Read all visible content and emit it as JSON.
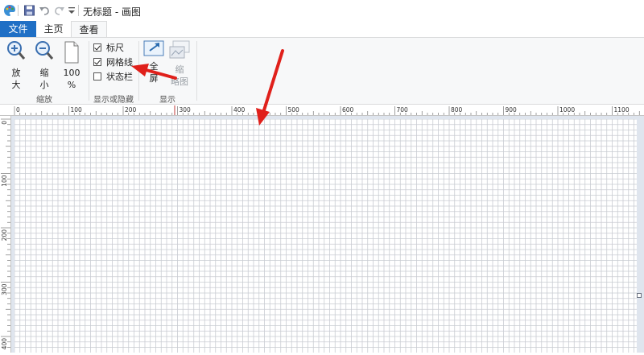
{
  "window": {
    "title": "无标题 - 画图"
  },
  "quick_access": {
    "icons": [
      "paint-app-icon",
      "save-icon",
      "undo-icon",
      "redo-icon",
      "customize-dropdown-icon"
    ]
  },
  "tabs": [
    {
      "label": "文件",
      "active": false
    },
    {
      "label": "主页",
      "active": false
    },
    {
      "label": "查看",
      "active": true
    }
  ],
  "ribbon": {
    "zoom_group": {
      "label": "缩放",
      "zoom_in": {
        "line1": "放",
        "line2": "大"
      },
      "zoom_out": {
        "line1": "缩",
        "line2": "小"
      },
      "actual_size": {
        "line1": "100",
        "line2": "%"
      }
    },
    "show_hide_group": {
      "label": "显示或隐藏",
      "checkboxes": [
        {
          "label": "标尺",
          "checked": true
        },
        {
          "label": "网格线",
          "checked": true
        },
        {
          "label": "状态栏",
          "checked": false
        }
      ]
    },
    "display_group": {
      "label": "显示",
      "fullscreen": {
        "line1": "全",
        "line2": "屏"
      },
      "thumbnail": {
        "line1": "缩",
        "line2": "略图"
      }
    }
  },
  "rulers": {
    "horizontal_ticks": [
      "0",
      "100",
      "200",
      "300",
      "400",
      "500",
      "600",
      "700",
      "800",
      "900",
      "1000",
      "1100"
    ],
    "vertical_ticks": [
      "0",
      "100",
      "200",
      "300",
      "400"
    ]
  },
  "colors": {
    "file_tab": "#1f6fc5",
    "annotation_arrow": "#e0201b",
    "grid_line": "#c9ccd2"
  }
}
